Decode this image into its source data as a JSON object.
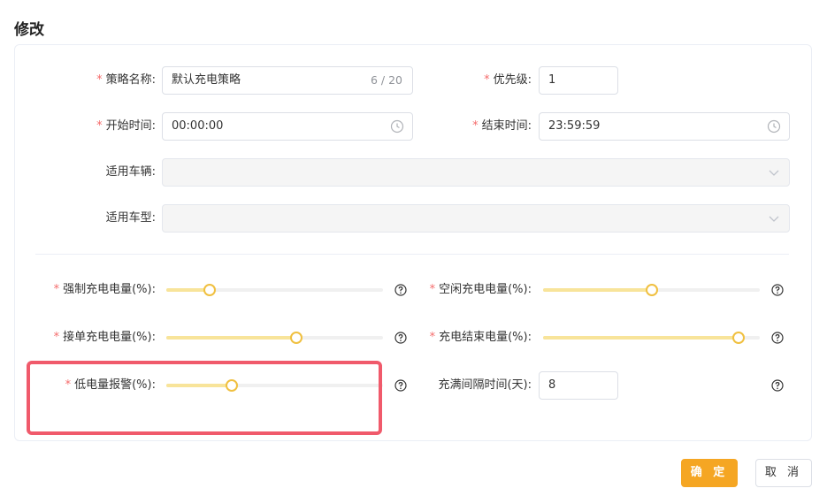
{
  "dialog": {
    "title": "修改"
  },
  "form": {
    "strategy_name": {
      "label": "策略名称:",
      "value": "默认充电策略",
      "counter": "6 / 20"
    },
    "priority": {
      "label": "优先级:",
      "value": "1"
    },
    "start_time": {
      "label": "开始时间:",
      "value": "00:00:00"
    },
    "end_time": {
      "label": "结束时间:",
      "value": "23:59:59"
    },
    "vehicles": {
      "label": "适用车辆:",
      "value": ""
    },
    "vehicle_models": {
      "label": "适用车型:",
      "value": ""
    },
    "forced_charge": {
      "label": "强制充电电量(%):",
      "percent": 20
    },
    "idle_charge": {
      "label": "空闲充电电量(%):",
      "percent": 50
    },
    "order_charge": {
      "label": "接单充电电量(%):",
      "percent": 60
    },
    "charge_end": {
      "label": "充电结束电量(%):",
      "percent": 90
    },
    "low_battery_alarm": {
      "label": "低电量报警(%):",
      "percent": 30
    },
    "full_interval": {
      "label": "充满间隔时间(天):",
      "value": "8"
    }
  },
  "buttons": {
    "confirm": "确 定",
    "cancel": "取 消"
  },
  "icons": {
    "clock": "clock-icon",
    "chevron": "chevron-down-icon",
    "help": "question-circle-icon"
  },
  "colors": {
    "accent": "#f5a623",
    "slider_fill": "#f8e49a",
    "required": "#f56c6c",
    "highlight": "#f05a6b"
  }
}
